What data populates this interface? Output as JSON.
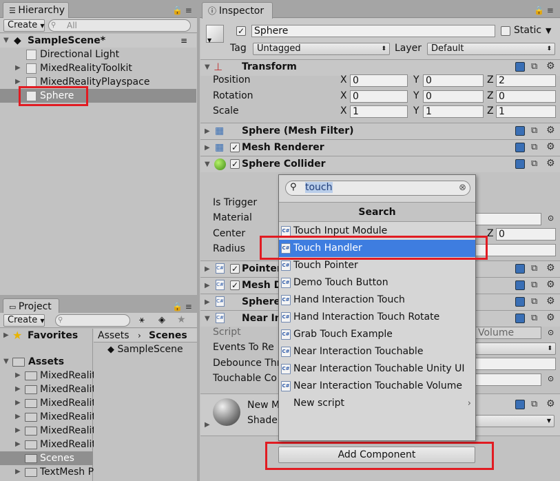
{
  "hierarchy": {
    "tab_label": "Hierarchy",
    "create_label": "Create",
    "search_placeholder": "All",
    "scene_name": "SampleScene*",
    "items": [
      {
        "label": "Directional Light"
      },
      {
        "label": "MixedRealityToolkit"
      },
      {
        "label": "MixedRealityPlayspace"
      },
      {
        "label": "Sphere"
      }
    ]
  },
  "project": {
    "tab_label": "Project",
    "create_label": "Create",
    "favorites_label": "Favorites",
    "assets_label": "Assets",
    "folders": [
      "MixedRealit",
      "MixedRealit",
      "MixedRealit",
      "MixedRealit",
      "MixedRealit",
      "MixedRealit",
      "Scenes",
      "TextMesh P"
    ],
    "breadcrumb": {
      "root": "Assets",
      "current": "Scenes"
    },
    "files": [
      "SampleScene"
    ]
  },
  "inspector": {
    "tab_label": "Inspector",
    "object_name": "Sphere",
    "static_label": "Static",
    "tag_label": "Tag",
    "tag_value": "Untagged",
    "layer_label": "Layer",
    "layer_value": "Default",
    "transform": {
      "title": "Transform",
      "position_label": "Position",
      "rotation_label": "Rotation",
      "scale_label": "Scale",
      "x": "X",
      "y": "Y",
      "z": "Z",
      "position": [
        "0",
        "0",
        "2"
      ],
      "rotation": [
        "0",
        "0",
        "0"
      ],
      "scale": [
        "1",
        "1",
        "1"
      ]
    },
    "components": {
      "mesh_filter": "Sphere (Mesh Filter)",
      "mesh_renderer": "Mesh Renderer",
      "sphere_collider": "Sphere Collider",
      "pointer": "Pointer",
      "mesh_d": "Mesh D",
      "sphere": "Sphere",
      "near_in": "Near In"
    },
    "collider_fields": {
      "is_trigger": "Is Trigger",
      "material": "Material",
      "center": "Center",
      "center_z_label": "Z",
      "center_z": "0",
      "radius": "Radius"
    },
    "near_fields": {
      "script": "Script",
      "script_value": "Volume",
      "events_to": "Events To Re",
      "debounce": "Debounce Thr",
      "touchable": "Touchable Co"
    },
    "material_name": "New M",
    "shader_label": "Shade",
    "add_component_label": "Add Component"
  },
  "popup": {
    "search_value": "touch",
    "header": "Search",
    "items": [
      {
        "label": "Touch Input Module"
      },
      {
        "label": "Touch Handler"
      },
      {
        "label": "Touch Pointer"
      },
      {
        "label": "Demo Touch Button"
      },
      {
        "label": "Hand Interaction Touch"
      },
      {
        "label": "Hand Interaction Touch Rotate"
      },
      {
        "label": "Grab Touch Example"
      },
      {
        "label": "Near Interaction Touchable"
      },
      {
        "label": "Near Interaction Touchable Unity UI"
      },
      {
        "label": "Near Interaction Touchable Volume"
      },
      {
        "label": "New script"
      }
    ],
    "selected_index": 1
  },
  "colors": {
    "highlight": "#e11b22",
    "selection": "#3e7de0"
  }
}
